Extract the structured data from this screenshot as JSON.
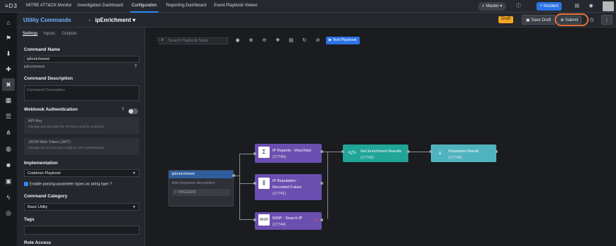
{
  "topnav": {
    "logo": "≡D3",
    "tabs": [
      {
        "label": "MITRE ATT&CK Monitor"
      },
      {
        "label": "Investigation Dashboard"
      },
      {
        "label": "Configuration",
        "active": true
      },
      {
        "label": "Reporting Dashboard"
      },
      {
        "label": "Event Playbook Viewer"
      }
    ],
    "tenant": "Master",
    "incident_button": "+ Incident"
  },
  "breadcrumb": {
    "parent": "Utility Commands",
    "separator": "›",
    "current": "ipEnrichment ▾"
  },
  "header": {
    "status": "Draft",
    "save_draft": "Save Draft",
    "submit": "Submit"
  },
  "panel": {
    "tabs": [
      "Settings",
      "Inputs",
      "Outputs"
    ],
    "command_name_label": "Command Name",
    "command_name_value": "ipEnrichment",
    "command_name_sub": "ipEnrichment",
    "description_label": "Command Description",
    "description_placeholder": "Command Description",
    "webhook_label": "Webhook Authentication",
    "api_key_title": "API Key",
    "api_key_desc": "Manage and generate the API keys used for webhook",
    "jwt_title": "JSON Web Token (JWT)",
    "jwt_desc": "Manage secret keys and configure JWT authentication",
    "implementation_label": "Implementation",
    "implementation_value": "Codeless Playbook",
    "enable_parsing": "Enable parsing parameter types as string type",
    "category_label": "Command Category",
    "category_value": "Basic Utility",
    "tags_label": "Tags",
    "role_access_label": "Role Access"
  },
  "canvas": {
    "search_placeholder": "Search Playbook Tasks",
    "test_button": "Test Playbook",
    "start_node": {
      "title": "ipEnrichment",
      "description": "Add playbook description",
      "triggers": "> TRIGGERS"
    },
    "nodes": [
      {
        "title": "IP Reports - VirusTotal",
        "id": "(17740)"
      },
      {
        "title": "IP Reputation -",
        "title2": "Recorded Future",
        "id": "(17741)"
      },
      {
        "title": "MISP - Search IP",
        "id": "(17744)"
      },
      {
        "title": "Get Enrichment Results",
        "id": "(17742)"
      },
      {
        "title": "Passdown Result",
        "id": "(17743)"
      }
    ]
  },
  "colors": {
    "accent": "#2c8af3",
    "node_purple": "#6b4fb0",
    "node_teal": "#20a596",
    "node_teal_light": "#4fb3be",
    "start_node": "#2f5e9e",
    "submit_ring": "#e8743b"
  }
}
